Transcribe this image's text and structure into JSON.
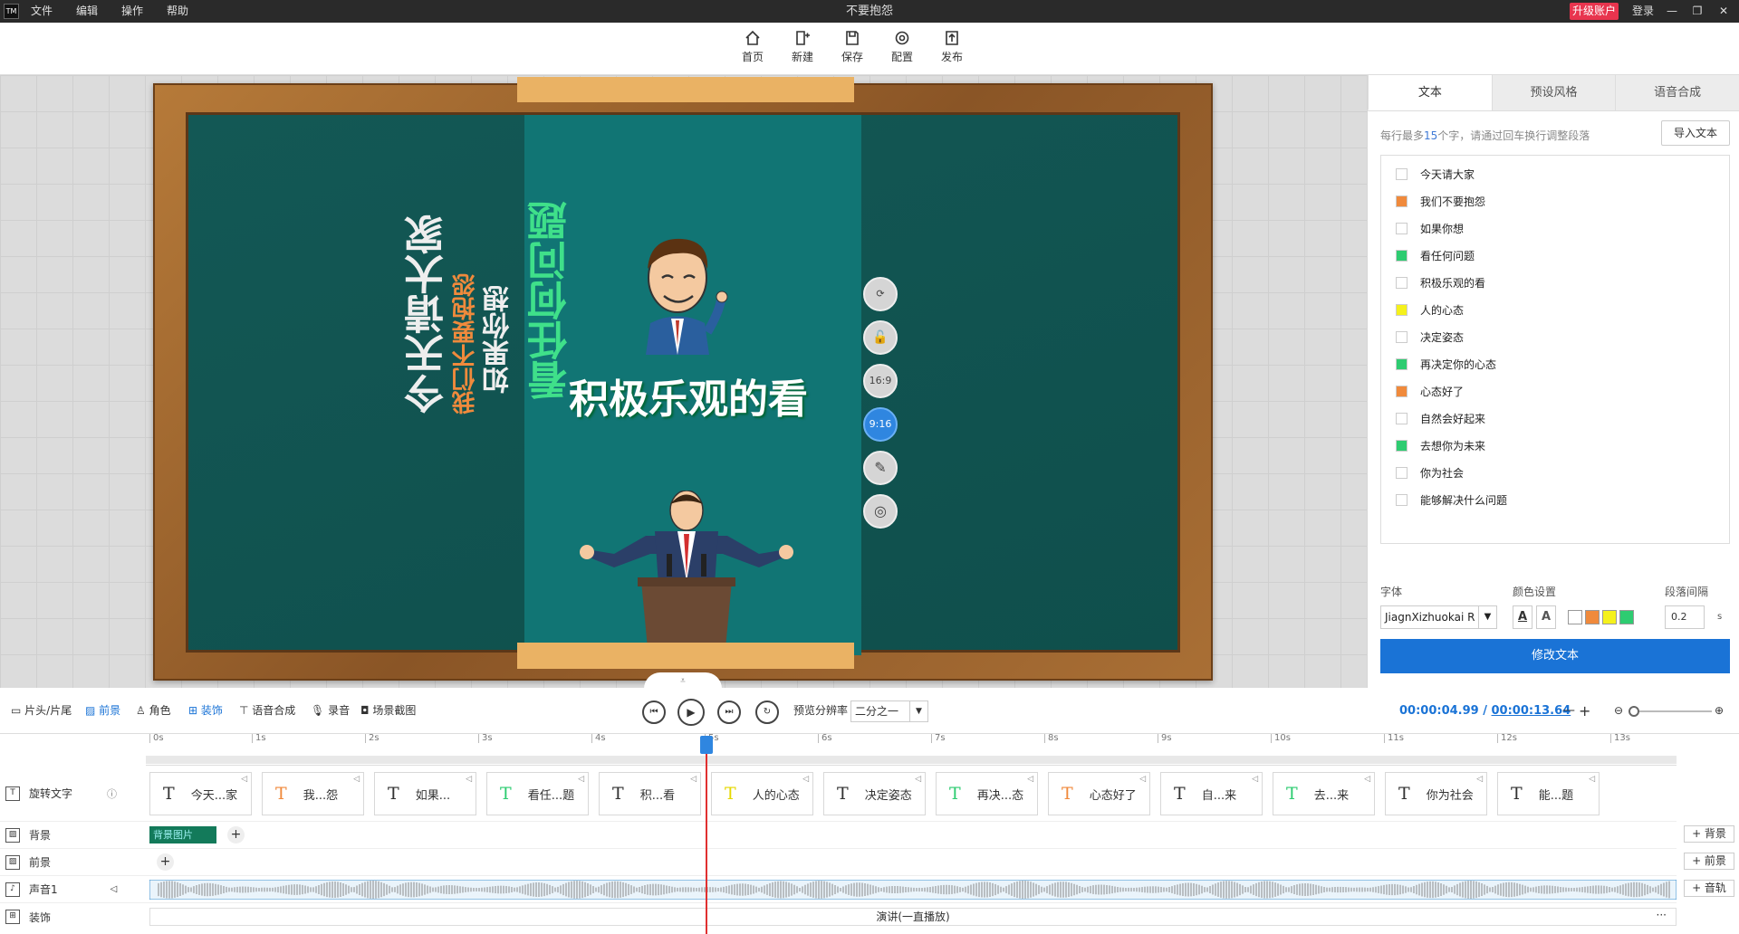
{
  "titlebar": {
    "logo": "TM",
    "menu": [
      "文件",
      "编辑",
      "操作",
      "帮助"
    ],
    "title": "不要抱怨",
    "upgrade": "升级账户",
    "login": "登录",
    "win_controls": [
      "—",
      "❐",
      "✕"
    ]
  },
  "toolbar": {
    "items": [
      {
        "label": "首页",
        "icon": "home-icon"
      },
      {
        "label": "新建",
        "icon": "new-icon"
      },
      {
        "label": "保存",
        "icon": "save-icon"
      },
      {
        "label": "配置",
        "icon": "config-icon"
      },
      {
        "label": "发布",
        "icon": "publish-icon"
      }
    ]
  },
  "canvas": {
    "texts": {
      "line1": "今天请大家",
      "line2": "我们不要抱怨",
      "line3": "如果你想",
      "line4": "看任何问题",
      "line5": "积极乐观的看"
    },
    "side_buttons": [
      "⟳",
      "🔓",
      "16:9",
      "9:16",
      "✎",
      "◎"
    ],
    "active_ratio": "9:16",
    "collapse": "⩡"
  },
  "panel": {
    "tabs": [
      "文本",
      "预设风格",
      "语音合成"
    ],
    "hint_prefix": "每行最多",
    "hint_num": "15",
    "hint_suffix": "个字，请通过回车换行调整段落",
    "import_button": "导入文本",
    "lines": [
      {
        "text": "今天请大家",
        "color": "#ffffff"
      },
      {
        "text": "我们不要抱怨",
        "color": "#f08a3c"
      },
      {
        "text": "如果你想",
        "color": "#ffffff"
      },
      {
        "text": "看任何问题",
        "color": "#2ecc71"
      },
      {
        "text": "积极乐观的看",
        "color": "#ffffff"
      },
      {
        "text": "人的心态",
        "color": "#f5f11c"
      },
      {
        "text": "决定姿态",
        "color": "#ffffff"
      },
      {
        "text": "再决定你的心态",
        "color": "#2ecc71"
      },
      {
        "text": "心态好了",
        "color": "#f08a3c"
      },
      {
        "text": "自然会好起来",
        "color": "#ffffff"
      },
      {
        "text": "去想你为未来",
        "color": "#2ecc71"
      },
      {
        "text": "你为社会",
        "color": "#ffffff"
      },
      {
        "text": "能够解决什么问题",
        "color": "#ffffff"
      }
    ],
    "font_label": "字体",
    "font_value": "JiagnXizhuokai R",
    "color_label": "颜色设置",
    "spacing_label": "段落间隔",
    "spacing_value": "0.2",
    "spacing_unit": "s",
    "palette": [
      "#ffffff",
      "#f08a3c",
      "#f5f11c",
      "#2ecc71"
    ],
    "modify_button": "修改文本"
  },
  "bottom": {
    "tools": [
      "片头/片尾",
      "前景",
      "角色",
      "装饰",
      "语音合成",
      "录音",
      "场景截图"
    ],
    "selected_tools": [
      "前景",
      "装饰"
    ],
    "preview_label": "预览分辨率",
    "preview_value": "二分之一",
    "current_time": "00:00:04.99",
    "separator": "/",
    "total_time": "00:00:13.64",
    "minus": "—",
    "plus": "+"
  },
  "timeline": {
    "ticks": [
      "0s",
      "1s",
      "2s",
      "3s",
      "4s",
      "5s",
      "6s",
      "7s",
      "8s",
      "9s",
      "10s",
      "11s",
      "12s",
      "13s"
    ],
    "tracks": {
      "text": "旋转文字",
      "background": "背景",
      "foreground": "前景",
      "audio": "声音1",
      "decoration": "装饰"
    },
    "clips": [
      {
        "label": "今天...家",
        "t_color": "#333333"
      },
      {
        "label": "我...怨",
        "t_color": "#f08a3c"
      },
      {
        "label": "如果...",
        "t_color": "#333333"
      },
      {
        "label": "看任...题",
        "t_color": "#2ecc71"
      },
      {
        "label": "积...看",
        "t_color": "#333333"
      },
      {
        "label": "人的心态",
        "t_color": "#e6d800"
      },
      {
        "label": "决定姿态",
        "t_color": "#333333"
      },
      {
        "label": "再决...态",
        "t_color": "#2ecc71"
      },
      {
        "label": "心态好了",
        "t_color": "#f08a3c"
      },
      {
        "label": "自...来",
        "t_color": "#333333"
      },
      {
        "label": "去...来",
        "t_color": "#2ecc71"
      },
      {
        "label": "你为社会",
        "t_color": "#333333"
      },
      {
        "label": "能...题",
        "t_color": "#333333"
      }
    ],
    "bg_clip": "背景图片",
    "decoration_clip": "演讲(一直播放)",
    "add_background": "+ 背景",
    "add_foreground": "+ 前景",
    "add_audio": "+ 音轨"
  }
}
